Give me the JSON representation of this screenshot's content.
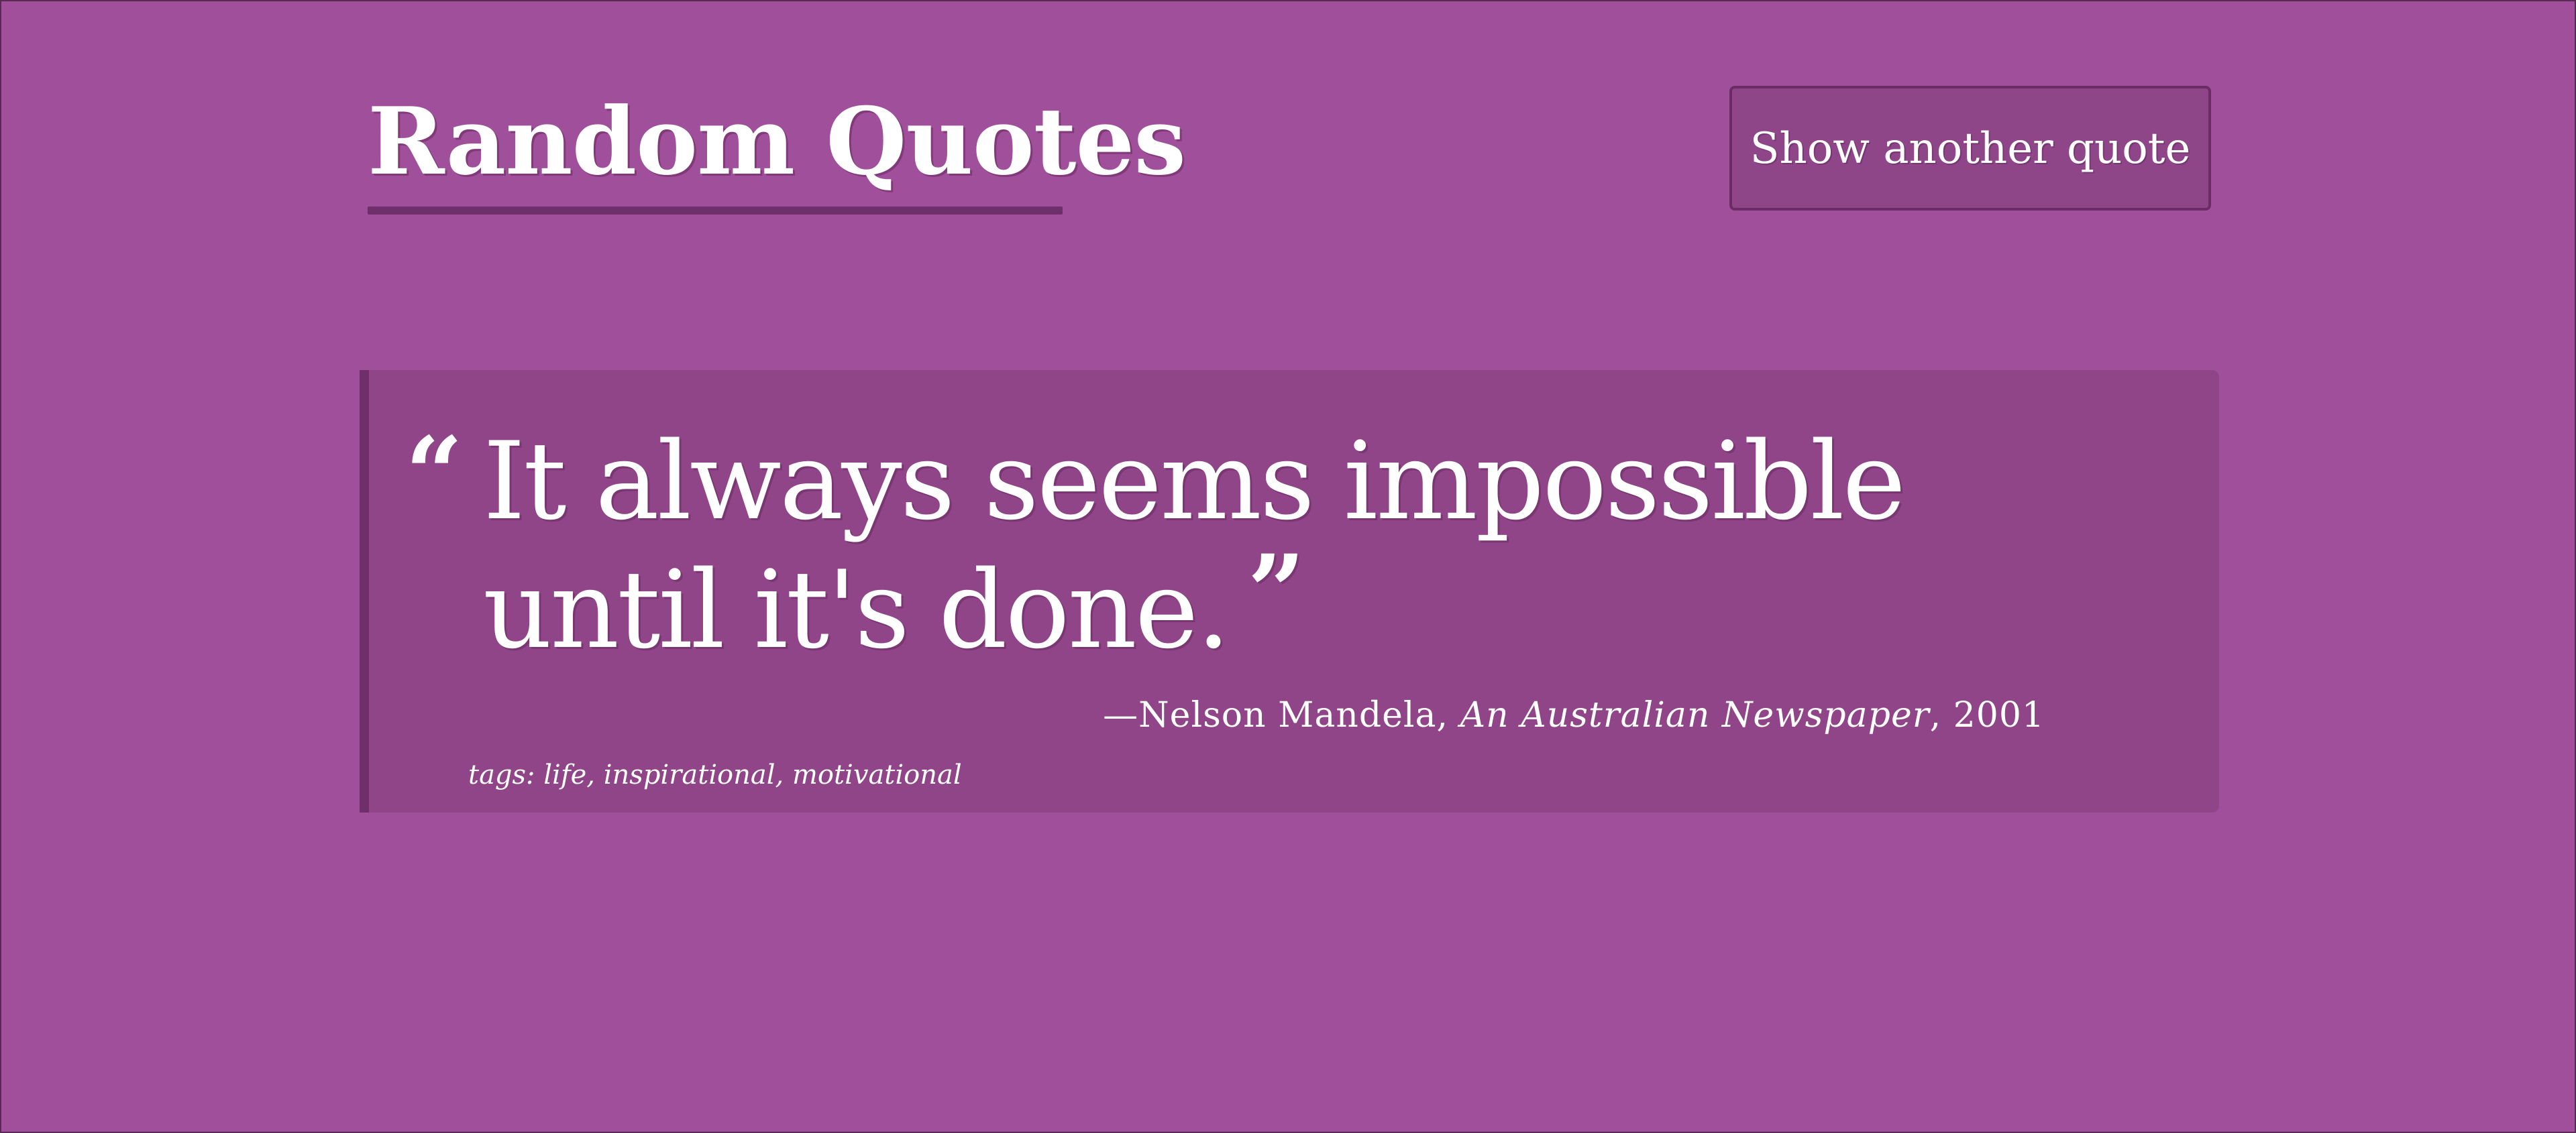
{
  "header": {
    "title": "Random Quotes",
    "another_button_label": "Show another quote"
  },
  "quote": {
    "open_mark": "“",
    "text": "It always seems impossible until it's done.",
    "close_mark": "”",
    "attribution_prefix": "—Nelson Mandela, ",
    "source": "An Australian Newspaper",
    "year_suffix": ", 2001",
    "tags_label": "tags: life, inspirational, motivational"
  },
  "colors": {
    "background": "#a04f9a",
    "card": "#8f4587",
    "accent": "#6e2f6b",
    "text": "#ffffff"
  }
}
